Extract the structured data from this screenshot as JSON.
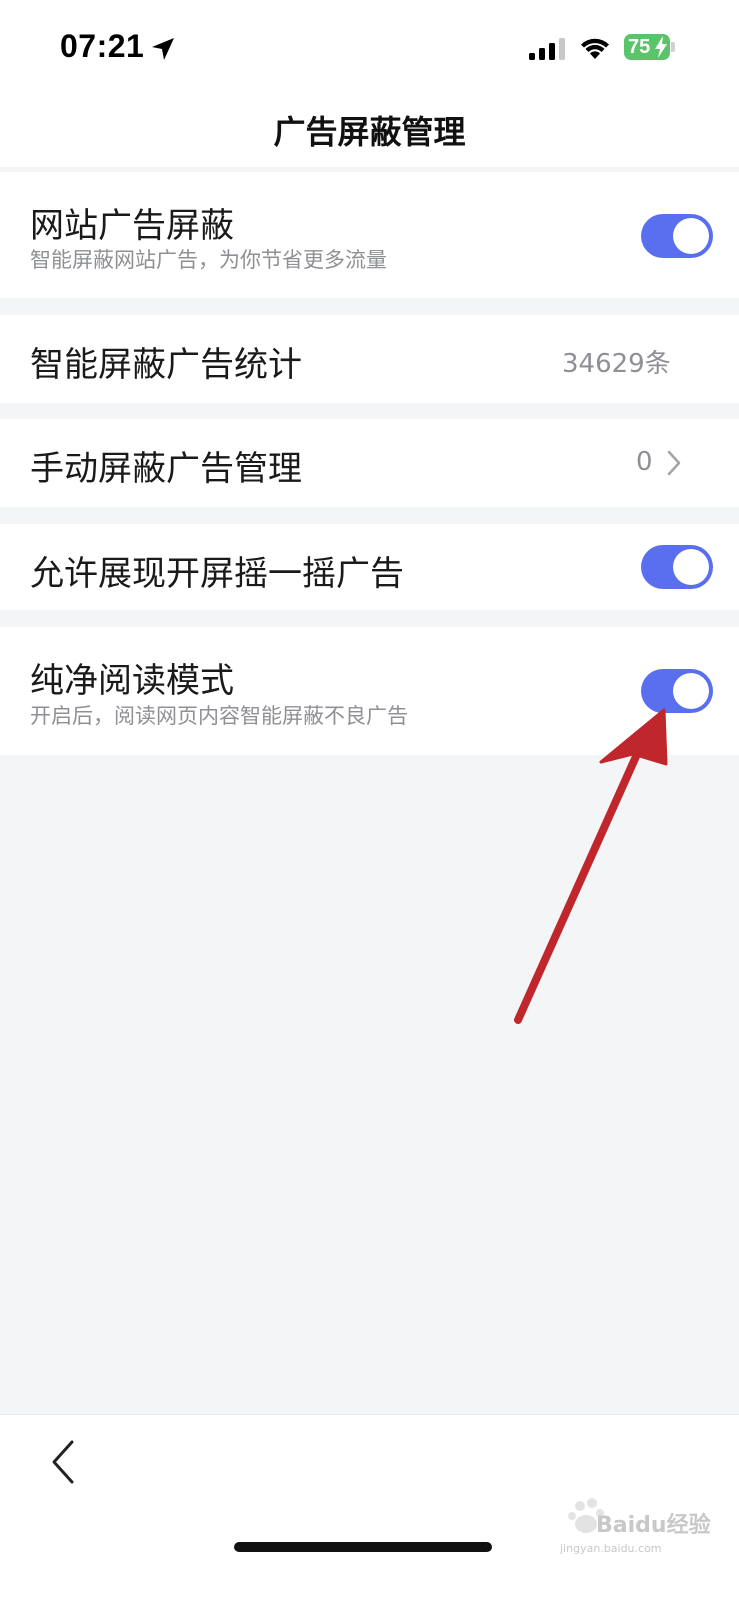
{
  "status_bar": {
    "time": "07:21",
    "battery_level": "75",
    "icons": [
      "location-arrow-icon",
      "signal-icon",
      "wifi-icon",
      "battery-icon",
      "charging-bolt-icon"
    ]
  },
  "header": {
    "title": "广告屏蔽管理"
  },
  "settings": {
    "website_ad_block": {
      "title": "网站广告屏蔽",
      "subtitle": "智能屏蔽网站广告，为你节省更多流量",
      "enabled": true
    },
    "smart_block_stats": {
      "title": "智能屏蔽广告统计",
      "value": "34629条"
    },
    "manual_block": {
      "title": "手动屏蔽广告管理",
      "value": "0"
    },
    "shake_ad": {
      "title": "允许展现开屏摇一摇广告",
      "enabled": true
    },
    "pure_reading": {
      "title": "纯净阅读模式",
      "subtitle": "开启后，阅读网页内容智能屏蔽不良广告",
      "enabled": true
    }
  },
  "colors": {
    "toggle_on": "#5a6ff0",
    "background": "#f4f5f7",
    "annotation_arrow": "#c0272d"
  },
  "watermark": {
    "brand": "Baidu经验",
    "url": "jingyan.baidu.com"
  }
}
